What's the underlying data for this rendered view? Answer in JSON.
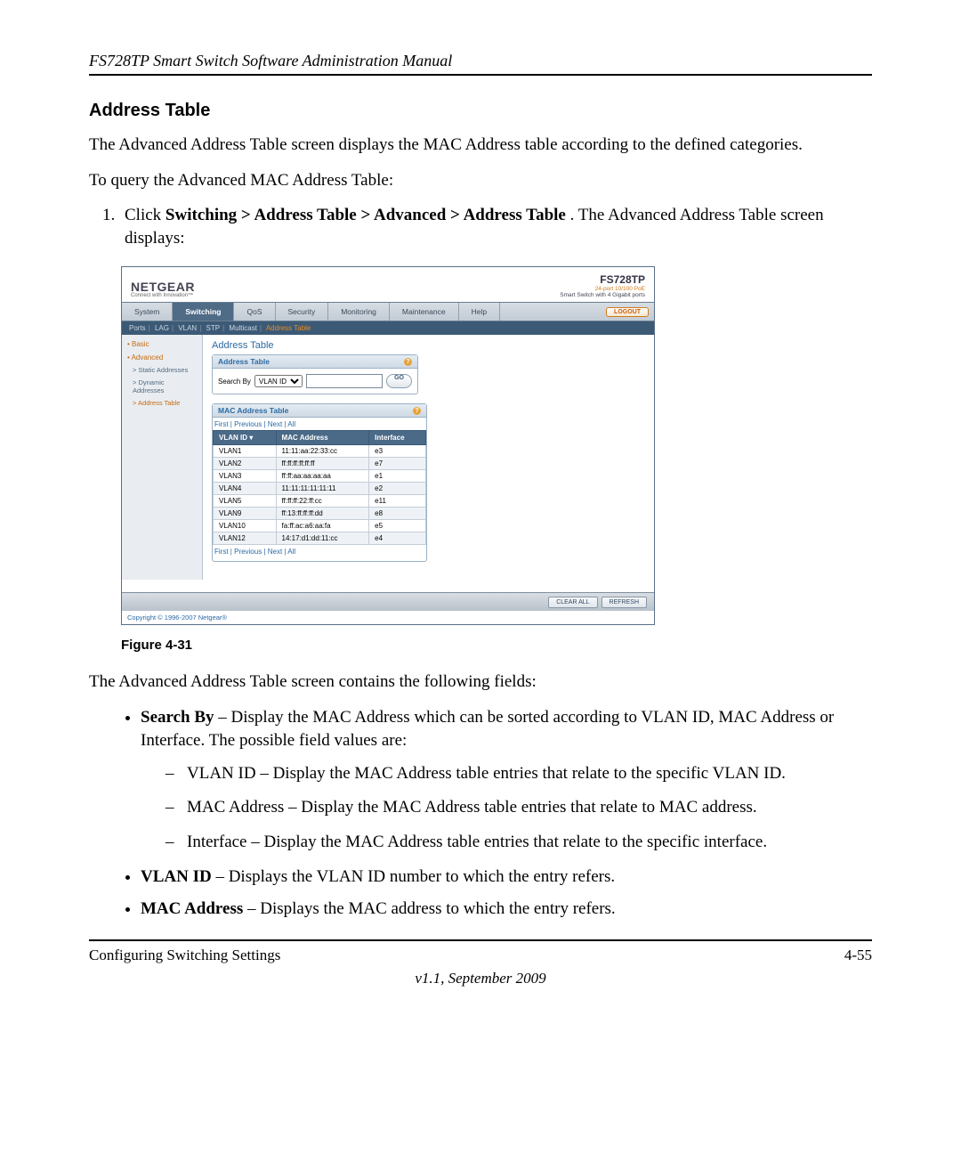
{
  "doc": {
    "running_header": "FS728TP Smart Switch Software Administration Manual",
    "section_title": "Address Table",
    "intro": "The Advanced Address Table screen displays the MAC Address table according to the defined categories.",
    "lead_in": "To query the Advanced MAC Address Table:",
    "step1_prefix": "Click ",
    "step1_path": "Switching > Address Table > Advanced > Address Table",
    "step1_suffix": ". The Advanced Address Table screen displays:",
    "figure_caption": "Figure 4-31",
    "after_figure": "The Advanced Address Table screen contains the following fields:",
    "bullets": {
      "b1_label": "Search By",
      "b1_text": " – Display the MAC Address which can be sorted according to VLAN ID, MAC Address or Interface. The possible field values are:",
      "b1_s1": "VLAN ID – Display the MAC Address table entries that relate to the specific VLAN ID.",
      "b1_s2": "MAC Address – Display the MAC Address table entries that relate to MAC address.",
      "b1_s3": "Interface – Display the MAC Address table entries that relate to the specific interface.",
      "b2_label": "VLAN ID",
      "b2_text": " – Displays the VLAN ID number to which the entry refers.",
      "b3_label": "MAC Address",
      "b3_text": " – Displays the MAC address to which the entry refers."
    },
    "footer_left": "Configuring Switching Settings",
    "footer_right": "4-55",
    "version_line": "v1.1, September 2009"
  },
  "app": {
    "brand": "NETGEAR",
    "tagline": "Connect with Innovation™",
    "model": "FS728TP",
    "model_sub1": "24-port 10/100 PoE",
    "model_sub2": "Smart Switch with 4 Gigabit ports",
    "topnav": {
      "items": [
        "System",
        "Switching",
        "QoS",
        "Security",
        "Monitoring",
        "Maintenance",
        "Help"
      ],
      "active_index": 1,
      "logout": "LOGOUT"
    },
    "subnav": {
      "items": [
        "Ports",
        "LAG",
        "VLAN",
        "STP",
        "Multicast",
        "Address Table"
      ],
      "active_index": 5
    },
    "sidebar": {
      "basic": "• Basic",
      "advanced": "• Advanced",
      "items": [
        "> Static Addresses",
        "> Dynamic Addresses",
        "> Address Table"
      ],
      "active_child_index": 2
    },
    "main": {
      "page_title": "Address Table",
      "panel1_title": "Address Table",
      "search_by_label": "Search By",
      "search_by_options": [
        "VLAN ID"
      ],
      "search_by_value": "VLAN ID",
      "search_input_value": "",
      "go": "GO",
      "panel2_title": "MAC Address Table",
      "pagination": "First | Previous | Next | All",
      "columns": [
        "VLAN ID ▾",
        "MAC Address",
        "Interface"
      ],
      "rows": [
        [
          "VLAN1",
          "11:11:aa:22:33:cc",
          "e3"
        ],
        [
          "VLAN2",
          "ff:ff:ff:ff:ff:ff",
          "e7"
        ],
        [
          "VLAN3",
          "ff:ff:aa:aa:aa:aa",
          "e1"
        ],
        [
          "VLAN4",
          "11:11:11:11:11:11",
          "e2"
        ],
        [
          "VLAN5",
          "ff:ff:ff:22:ff:cc",
          "e11"
        ],
        [
          "VLAN9",
          "ff:13:ff:ff:ff:dd",
          "e8"
        ],
        [
          "VLAN10",
          "fa:ff:ac:a6:aa:fa",
          "e5"
        ],
        [
          "VLAN12",
          "14:17:d1:dd:11:cc",
          "e4"
        ]
      ],
      "pagination2": "First | Previous | Next | All",
      "clear_all": "CLEAR ALL",
      "refresh": "REFRESH"
    },
    "copyright": "Copyright © 1996-2007 Netgear®"
  }
}
